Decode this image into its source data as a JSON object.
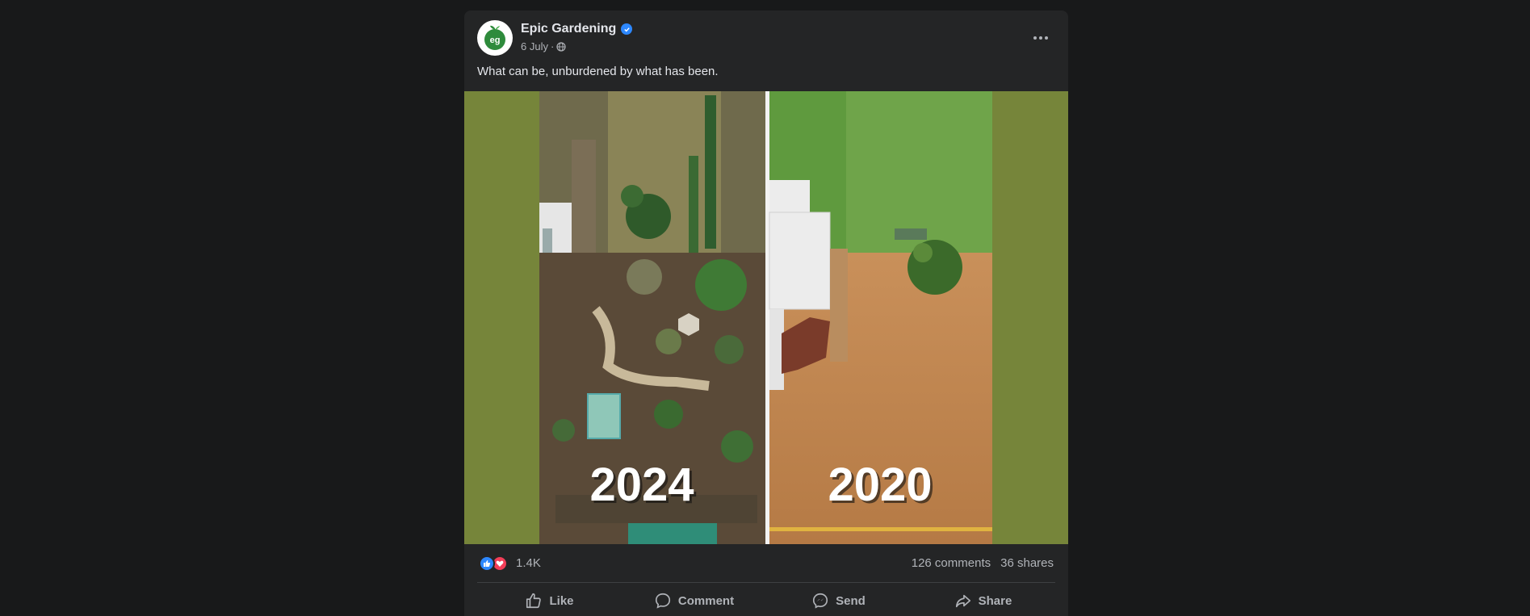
{
  "post": {
    "page_name": "Epic Gardening",
    "date": "6 July",
    "separator": "·",
    "caption": "What can be, unburdened by what has been.",
    "image": {
      "left_label": "2024",
      "right_label": "2020"
    },
    "reactions": {
      "count": "1.4K",
      "comments": "126 comments",
      "shares": "36 shares"
    },
    "actions": {
      "like": "Like",
      "comment": "Comment",
      "send": "Send",
      "share": "Share"
    }
  },
  "colors": {
    "page_background": "#18191a",
    "card_background": "#242526",
    "image_background": "#76853a",
    "verified": "#2d88ff",
    "like": "#2d88ff",
    "love": "#f33e58",
    "brand": "#2e8b3c"
  },
  "icons": [
    "verified-icon",
    "globe-icon",
    "more-icon",
    "like-reaction-icon",
    "love-reaction-icon",
    "like-icon",
    "comment-icon",
    "send-icon",
    "share-icon"
  ]
}
